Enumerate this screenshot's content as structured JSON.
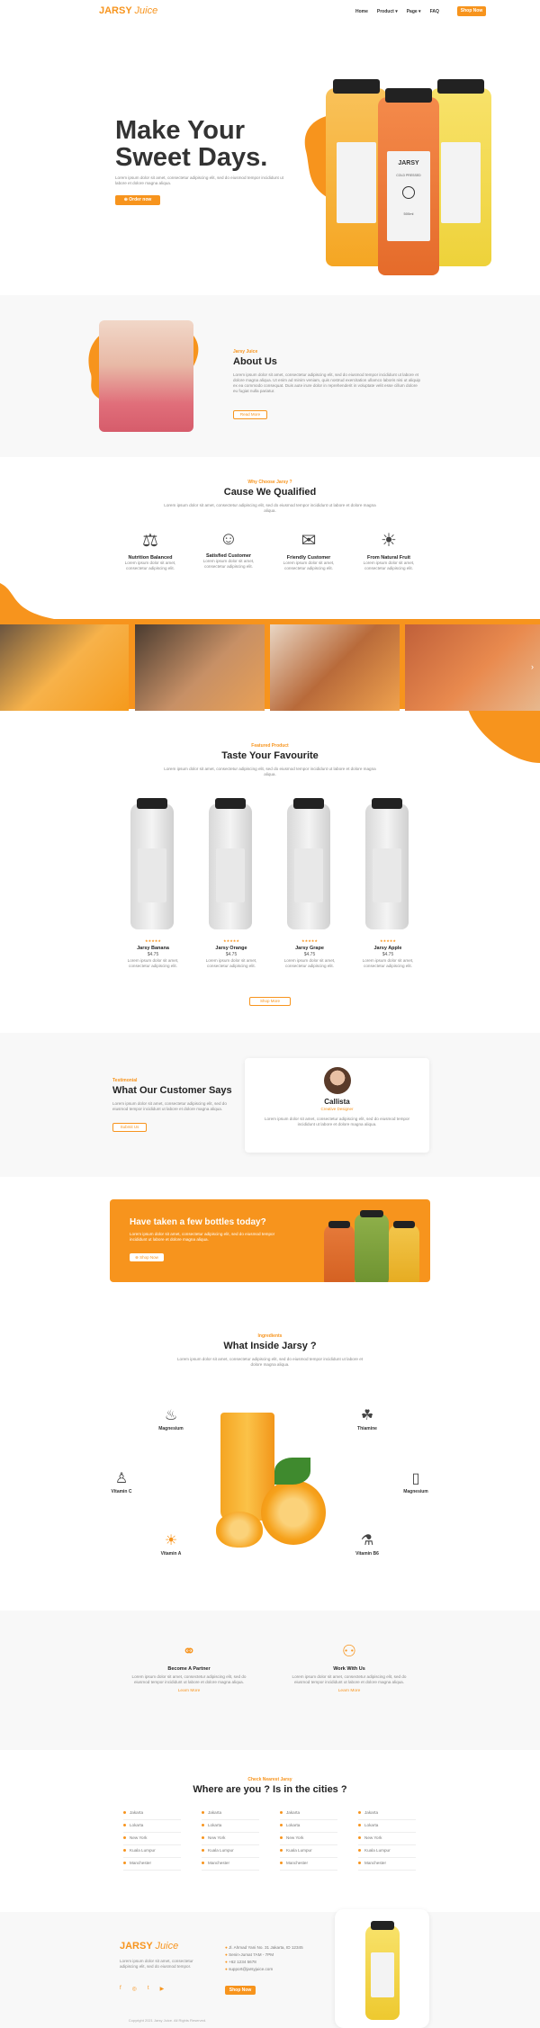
{
  "colors": {
    "accent": "#f7941d",
    "dark": "#222222",
    "light_bg": "#f8f8f8"
  },
  "nav": {
    "logo_brand": "JARSY",
    "logo_suffix": "Juice",
    "items": [
      "Home",
      "Product",
      "Page",
      "FAQ"
    ],
    "cta": "Shop Now"
  },
  "hero": {
    "title_line1": "Make Your",
    "title_line2": "Sweet Days.",
    "desc": "Lorem ipsum dolor sit amet, consectetur adipiscing elit, sed do eiusmod tempor incididunt ut labore et dolore magna aliqua.",
    "button": "Order now"
  },
  "about": {
    "sub": "Jarsy Juice",
    "title": "About Us",
    "text": "Lorem ipsum dolor sit amet, consectetur adipiscing elit, sed do eiusmod tempor incididunt ut labore et dolore magna aliqua. Ut enim ad minim veniam, quis nostrud exercitation ullamco laboris nisi ut aliquip ex ea commodo consequat. Duis aute irure dolor in reprehenderit in voluptate velit esse cillum dolore eu fugiat nulla pariatur.",
    "button": "Read More"
  },
  "why": {
    "sub": "Why Choose Jarsy ?",
    "title": "Cause We Qualified",
    "desc": "Lorem ipsum dolor sit amet, consectetur adipiscing elit, sed do eiusmod tempor incididunt ut labore et dolore magna aliqua.",
    "features": [
      {
        "icon": "balance-icon",
        "title": "Nutrition Balanced",
        "text": "Lorem ipsum dolor sit amet, consectetur adipiscing elit."
      },
      {
        "icon": "customer-icon",
        "title": "Satisfied Customer",
        "text": "Lorem ipsum dolor sit amet, consectetur adipiscing elit."
      },
      {
        "icon": "chat-icon",
        "title": "Friendly Customer",
        "text": "Lorem ipsum dolor sit amet, consectetur adipiscing elit."
      },
      {
        "icon": "leaf-icon",
        "title": "From Natural Fruit",
        "text": "Lorem ipsum dolor sit amet, consectetur adipiscing elit."
      }
    ]
  },
  "products": {
    "sub": "Featured Product",
    "title": "Taste Your Favourite",
    "desc": "Lorem ipsum dolor sit amet, consectetur adipiscing elit, sed do eiusmod tempor incididunt ut labore et dolore magna aliqua.",
    "bottle_brand": "JARSY",
    "bottle_sub": "Juice",
    "bottle_line1": "COLD PRESSED",
    "bottle_line2": "PREMIUM",
    "bottle_size": "500ml",
    "stars": "★★★★★",
    "items": [
      {
        "name": "Jarsy Banana",
        "price": "$4.75",
        "text": "Lorem ipsum dolor sit amet, consectetur adipiscing elit."
      },
      {
        "name": "Jarsy Orange",
        "price": "$4.75",
        "text": "Lorem ipsum dolor sit amet, consectetur adipiscing elit."
      },
      {
        "name": "Jarsy Grape",
        "price": "$4.75",
        "text": "Lorem ipsum dolor sit amet, consectetur adipiscing elit."
      },
      {
        "name": "Jarsy Apple",
        "price": "$4.75",
        "text": "Lorem ipsum dolor sit amet, consectetur adipiscing elit."
      }
    ],
    "button": "Shop More"
  },
  "testimonial": {
    "sub": "Testimonial",
    "title": "What Our Customer Says",
    "text": "Lorem ipsum dolor sit amet, consectetur adipiscing elit, sed do eiusmod tempor incididunt ut labore et dolore magna aliqua.",
    "button": "Submit Us",
    "name": "Callista",
    "role": "Creative Designer",
    "quote": "Lorem ipsum dolor sit amet, consectetur adipiscing elit, sed do eiusmod tempor incididunt ut labore et dolore magna aliqua."
  },
  "cta": {
    "title": "Have taken a few bottles today?",
    "text": "Lorem ipsum dolor sit amet, consectetur adipiscing elit, sed do eiusmod tempor incididunt ut labore et dolore magna aliqua.",
    "button": "Shop Now"
  },
  "ingredients": {
    "sub": "Ingredients",
    "title": "What Inside Jarsy ?",
    "desc": "Lorem ipsum dolor sit amet, consectetur adipiscing elit, sed do eiusmod tempor incididunt ut labore et dolore magna aliqua.",
    "items": {
      "magnesium1": "Magnesium",
      "thiamine": "Thiamine",
      "vitamin_c": "Vitamin C",
      "magnesium2": "Magnesium",
      "vitamin_a": "Vitamin A",
      "vitamin_b6": "Vitamin B6"
    }
  },
  "partner": {
    "items": [
      {
        "title": "Become A Partner",
        "text": "Lorem ipsum dolor sit amet, consectetur adipiscing elit, sed do eiusmod tempor incididunt ut labore et dolore magna aliqua.",
        "link": "Learn More"
      },
      {
        "title": "Work With Us",
        "text": "Lorem ipsum dolor sit amet, consectetur adipiscing elit, sed do eiusmod tempor incididunt ut labore et dolore magna aliqua.",
        "link": "Learn More"
      }
    ]
  },
  "cities": {
    "sub": "Check Nearest Jarsy",
    "title": "Where are you ? Is in the cities ?",
    "columns": [
      [
        "Jakarta",
        "Lokarta",
        "New York",
        "Kuala Lumpur",
        "Manchester"
      ],
      [
        "Jakarta",
        "Lokarta",
        "New York",
        "Kuala Lumpur",
        "Manchester"
      ],
      [
        "Jakarta",
        "Lokarta",
        "New York",
        "Kuala Lumpur",
        "Manchester"
      ],
      [
        "Jakarta",
        "Lokarta",
        "New York",
        "Kuala Lumpur",
        "Manchester"
      ]
    ]
  },
  "footer": {
    "text": "Lorem ipsum dolor sit amet, consectetur adipiscing elit, sed do eiusmod tempor.",
    "address": "Jl. Ahmad Yani No. 31 Jakarta, ID 12345",
    "hours": "Senin-Jumat 7AM - 7PM",
    "phone": "+62 1234 5678",
    "email": "support@jarsyjuice.com",
    "button": "Shop Now",
    "copyright": "Copyright 2021 Jarsy Juice. All Rights Reserved."
  }
}
